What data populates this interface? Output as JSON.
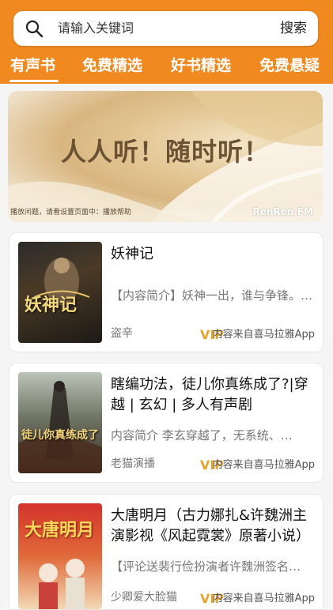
{
  "search": {
    "placeholder": "请输入关键词",
    "button_label": "搜索"
  },
  "tabs": [
    {
      "label": "有声书",
      "active": true
    },
    {
      "label": "免费精选",
      "active": false
    },
    {
      "label": "好书精选",
      "active": false
    },
    {
      "label": "免费悬疑",
      "active": false
    }
  ],
  "banner": {
    "headline": "人人听！随时听！",
    "note": "播放问题，请看设置页面中：播放帮助",
    "logo": "RenRen.FM"
  },
  "books": [
    {
      "title": "妖神记",
      "intro": "【内容简介】妖神一出，谁与争锋。…",
      "author": "盗辛",
      "vip": "VIP",
      "source": "内容来自喜马拉雅App",
      "cover_text": "妖神记"
    },
    {
      "title": "瞎编功法，徒儿你真练成了?|穿越 | 玄幻 | 多人有声剧",
      "intro": "内容简介 李玄穿越了，无系统、…",
      "author": "老猫演播",
      "vip": "VIP",
      "source": "内容来自喜马拉雅App",
      "cover_text": "徒儿你真练成了"
    },
    {
      "title": "大唐明月（古力娜扎&许魏洲主演影视《风起霓裳》原著小说）",
      "intro": "【评论送裴行俭扮演者许魏洲签名…",
      "author": "少卿爱大脸猫",
      "vip": "VIP",
      "source": "内容来自喜马拉雅App",
      "cover_text": "大唐明月"
    }
  ],
  "colors": {
    "header": "#f0891f",
    "vip": "#e8a32e"
  }
}
